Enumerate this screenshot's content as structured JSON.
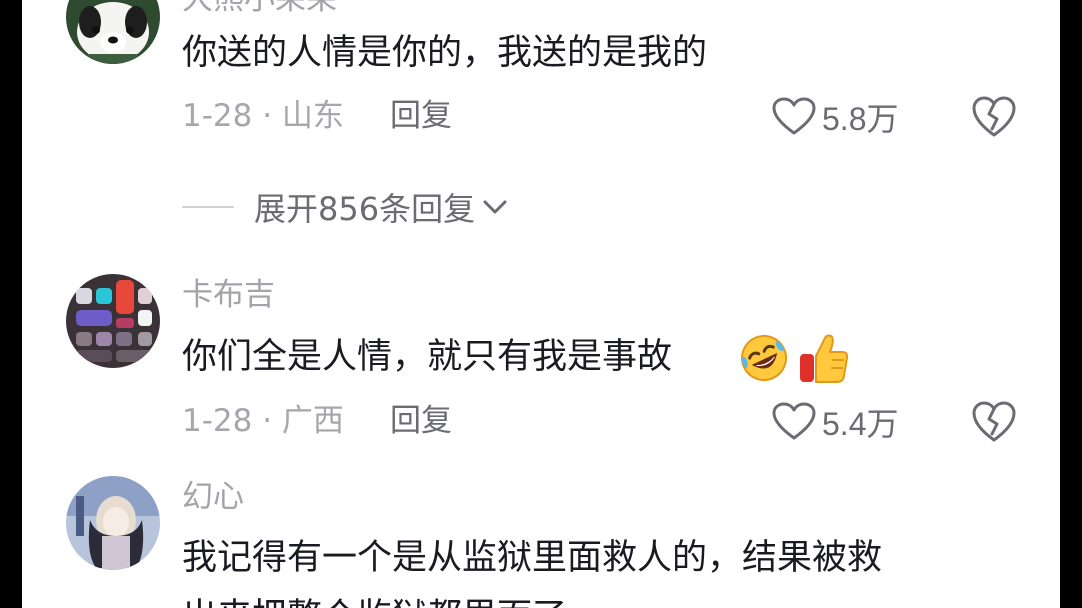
{
  "comments": [
    {
      "username": "大熊小呆呆",
      "text": "你送的人情是你的，我送的是我的",
      "date_location": "1-28 · 山东",
      "reply_label": "回复",
      "likes": "5.8万",
      "avatar_icon": "husky-dog-avatar"
    },
    {
      "username": "卡布吉",
      "text": "你们全是人情，就只有我是事故",
      "emojis": [
        "rofl-emoji",
        "thumbs-up-emoji"
      ],
      "date_location": "1-28 · 广西",
      "reply_label": "回复",
      "likes": "5.4万",
      "avatar_icon": "phone-control-center-avatar"
    },
    {
      "username": "幻心",
      "text": "我记得有一个是从监狱里面救人的，结果被救",
      "text_line2": "出来把整个监狱都里面了",
      "avatar_icon": "anime-girl-avatar"
    }
  ],
  "expand_replies": {
    "label": "展开856条回复",
    "icon": "chevron-down-icon"
  },
  "colors": {
    "text_primary": "#1a1a22",
    "text_secondary": "#a3a3a9",
    "action_gray": "#6b6b73",
    "background": "#ffffff",
    "letterbox": "#000000"
  }
}
